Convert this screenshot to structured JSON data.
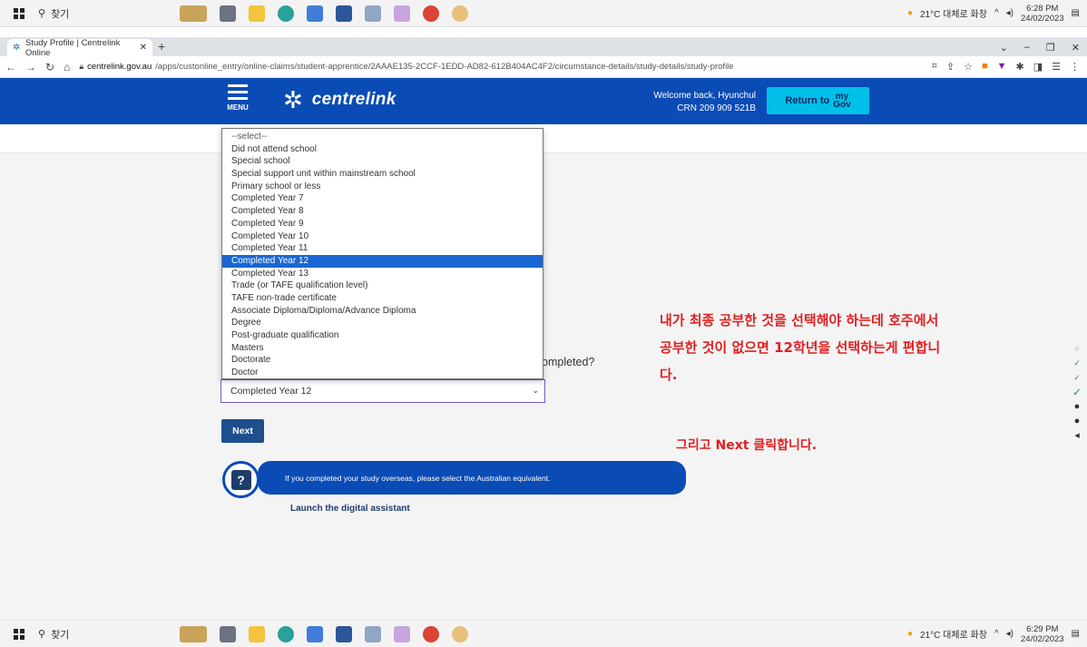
{
  "taskbar": {
    "search_label": "찾기",
    "weather": "21°C 대체로 화창",
    "top_clock": {
      "time": "6:28 PM",
      "date": "24/02/2023"
    },
    "bottom_clock": {
      "time": "6:29 PM",
      "date": "24/02/2023"
    }
  },
  "browser": {
    "tab_title": "Study Profile | Centrelink Online",
    "url_host": "centrelink.gov.au",
    "url_path": "/apps/custonline_entry/online-claims/student-apprentice/2AAAE135-2CCF-1EDD-AD82-612B404AC4F2/circumstance-details/study-details/study-profile"
  },
  "header": {
    "menu_label": "MENU",
    "brand": "centrelink",
    "welcome_line": "Welcome back, Hyunchul",
    "crn_line": "CRN 209 909 521B",
    "return_label": "Return to",
    "mygov_top": "my",
    "mygov_bottom": "Gov"
  },
  "form": {
    "question_suffix": "ompleted?",
    "selected_value": "Completed Year 12",
    "options": [
      "--select--",
      "Did not attend school",
      "Special school",
      "Special support unit within mainstream school",
      "Primary school or less",
      "Completed Year 7",
      "Completed Year 8",
      "Completed Year 9",
      "Completed Year 10",
      "Completed Year 11",
      "Completed Year 12",
      "Completed Year 13",
      "Trade (or TAFE qualification level)",
      "TAFE non-trade certificate",
      "Associate Diploma/Diploma/Advance Diploma",
      "Degree",
      "Post-graduate qualification",
      "Masters",
      "Doctorate",
      "Doctor"
    ],
    "selected_index": 10,
    "next_label": "Next"
  },
  "assistant": {
    "icon_glyph": "?",
    "tip": "If you completed your study overseas, please select the Australian equivalent.",
    "launch_label": "Launch the digital assistant"
  },
  "annotation": {
    "line1": "내가 최종 공부한 것을 선택해야 하는데 호주에서",
    "line2": "공부한 것이 없으면 12학년을 선택하는게 편합니",
    "line3": "다.",
    "line4": "그리고 Next 클릭합니다."
  },
  "colors": {
    "brand_blue": "#0a4bb5",
    "mygov_cyan": "#00bfe8",
    "annotation_red": "#e02020",
    "select_border": "#7a55c9"
  }
}
